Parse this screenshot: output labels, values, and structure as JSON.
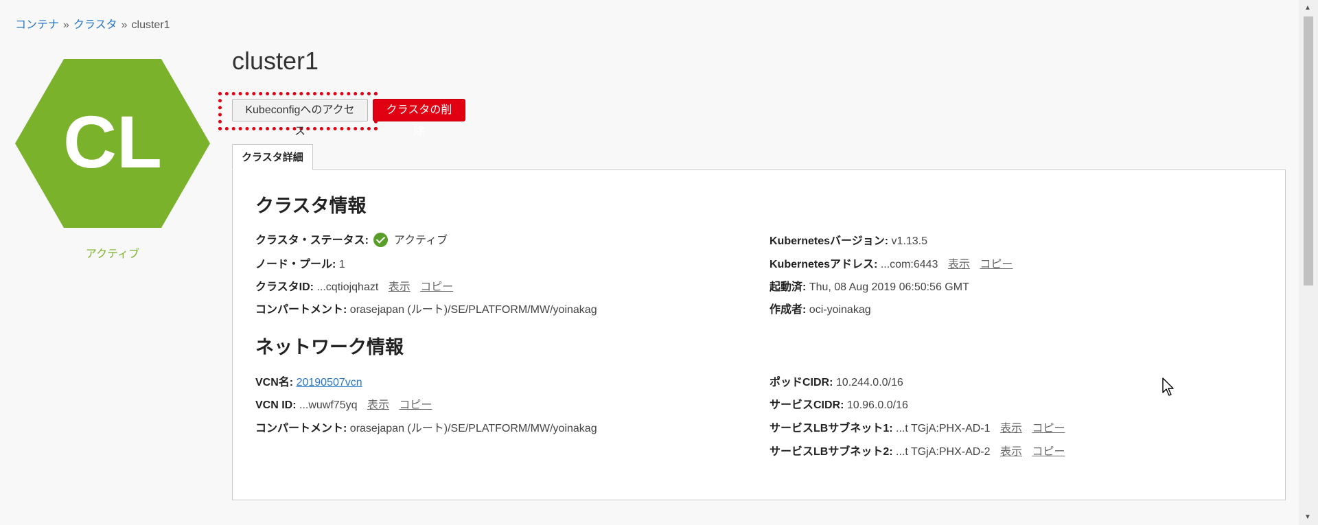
{
  "breadcrumb": {
    "items": [
      "コンテナ",
      "クラスタ"
    ],
    "separator": "»",
    "current": "cluster1"
  },
  "hex": {
    "initials": "CL",
    "color": "#7bb22c",
    "status": "アクティブ"
  },
  "page_title": "cluster1",
  "buttons": {
    "kubeconfig": "Kubeconfigへのアクセス",
    "delete": "クラスタの削除"
  },
  "tab": {
    "label": "クラスタ詳細"
  },
  "cluster_info": {
    "title": "クラスタ情報",
    "status_label": "クラスタ・ステータス:",
    "status_value": "アクティブ",
    "node_pool_label": "ノード・プール:",
    "node_pool_value": "1",
    "cluster_id_label": "クラスタID:",
    "cluster_id_value": "...cqtiojqhazt",
    "compartment_label": "コンパートメント:",
    "compartment_value": "orasejapan (ルート)/SE/PLATFORM/MW/yoinakag",
    "k8s_version_label": "Kubernetesバージョン:",
    "k8s_version_value": "v1.13.5",
    "k8s_address_label": "Kubernetesアドレス:",
    "k8s_address_value": "...com:6443",
    "started_label": "起動済:",
    "started_value": "Thu, 08 Aug 2019 06:50:56 GMT",
    "creator_label": "作成者:",
    "creator_value": "oci-yoinakag"
  },
  "network_info": {
    "title": "ネットワーク情報",
    "vcn_name_label": "VCN名:",
    "vcn_name_value": "20190507vcn",
    "vcn_id_label": "VCN ID:",
    "vcn_id_value": "...wuwf75yq",
    "compartment_label": "コンパートメント:",
    "compartment_value": "orasejapan (ルート)/SE/PLATFORM/MW/yoinakag",
    "pod_cidr_label": "ポッドCIDR:",
    "pod_cidr_value": "10.244.0.0/16",
    "service_cidr_label": "サービスCIDR:",
    "service_cidr_value": "10.96.0.0/16",
    "lb_subnet1_label": "サービスLBサブネット1:",
    "lb_subnet1_value": "...t TGjA:PHX-AD-1",
    "lb_subnet2_label": "サービスLBサブネット2:",
    "lb_subnet2_value": "...t TGjA:PHX-AD-2"
  },
  "actions": {
    "show": "表示",
    "copy": "コピー"
  }
}
